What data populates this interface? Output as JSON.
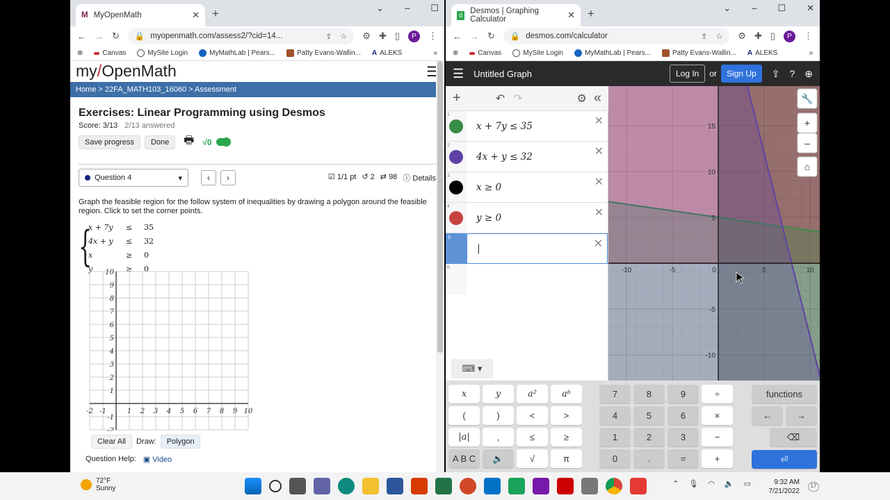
{
  "left_window": {
    "tab_title": "MyOpenMath",
    "url": "myopenmath.com/assess2/?cid=14...",
    "bookmarks": [
      "Canvas",
      "MySite Login",
      "MyMathLab | Pears...",
      "Patty Evans-Wallin...",
      "ALEKS"
    ],
    "site_logo_my": "my",
    "site_logo_open": "OpenMath",
    "breadcrumb": "Home > 22FA_MATH103_16060 > Assessment",
    "page_title": "Exercises: Linear Programming using Desmos",
    "score": "Score: 3/13",
    "answered": "2/13 answered",
    "save_label": "Save progress",
    "done_label": "Done",
    "question_select": "Question 4",
    "points": "1/1 pt",
    "tries": "2",
    "versions": "98",
    "details": "Details",
    "question_text": "Graph the feasible region for the follow system of inequalities by drawing a polygon around the feasible region. Click to set the corner points.",
    "system": [
      {
        "lhs": "x + 7y",
        "op": "≤",
        "rhs": "35"
      },
      {
        "lhs": "4x + y",
        "op": "≤",
        "rhs": "32"
      },
      {
        "lhs": "x",
        "op": "≥",
        "rhs": "0"
      },
      {
        "lhs": "y",
        "op": "≥",
        "rhs": "0"
      }
    ],
    "grid_y_labels": [
      "10",
      "9",
      "8",
      "7",
      "6",
      "5",
      "4",
      "3",
      "2",
      "1",
      "-1",
      "-2"
    ],
    "grid_x_labels": [
      "-2",
      "-1",
      "1",
      "2",
      "3",
      "4",
      "5",
      "6",
      "7",
      "8",
      "9",
      "10"
    ],
    "clear_all": "Clear All",
    "draw_label": "Draw:",
    "polygon_label": "Polygon",
    "question_help": "Question Help:",
    "video_label": "Video"
  },
  "right_window": {
    "tab_title": "Desmos | Graphing Calculator",
    "url": "desmos.com/calculator",
    "bookmarks": [
      "Canvas",
      "MySite Login",
      "MyMathLab | Pears...",
      "Patty Evans-Wallin...",
      "ALEKS"
    ],
    "graph_title": "Untitled Graph",
    "login": "Log In",
    "or": "or",
    "signup": "Sign Up",
    "expressions": [
      {
        "n": "1",
        "text": "x + 7y ≤ 35",
        "color": "#388c46"
      },
      {
        "n": "2",
        "text": "4x + y ≤ 32",
        "color": "#6042a6"
      },
      {
        "n": "3",
        "text": "x ≥ 0",
        "color": "#000000"
      },
      {
        "n": "4",
        "text": "y ≥ 0",
        "color": "#c74440"
      },
      {
        "n": "5",
        "text": "|",
        "color": ""
      },
      {
        "n": "6",
        "text": "",
        "color": ""
      }
    ],
    "axis_x_labels": [
      "-10",
      "-5",
      "0",
      "5",
      "10"
    ],
    "axis_y_labels": [
      "15",
      "10",
      "5",
      "-5",
      "-10"
    ],
    "keys_left": [
      "x",
      "y",
      "a²",
      "aᵇ",
      "(",
      ")",
      "<",
      ">",
      "|a|",
      ",",
      "≤",
      "≥",
      "A B C",
      "🔈",
      "√",
      "π"
    ],
    "keys_num": [
      "7",
      "8",
      "9",
      "÷",
      "4",
      "5",
      "6",
      "×",
      "1",
      "2",
      "3",
      "−",
      "0",
      ".",
      "=",
      "+"
    ],
    "functions": "functions"
  },
  "taskbar": {
    "temp": "72°F",
    "weather": "Sunny",
    "time": "9:32 AM",
    "date": "7/21/2022",
    "notif": "17"
  }
}
